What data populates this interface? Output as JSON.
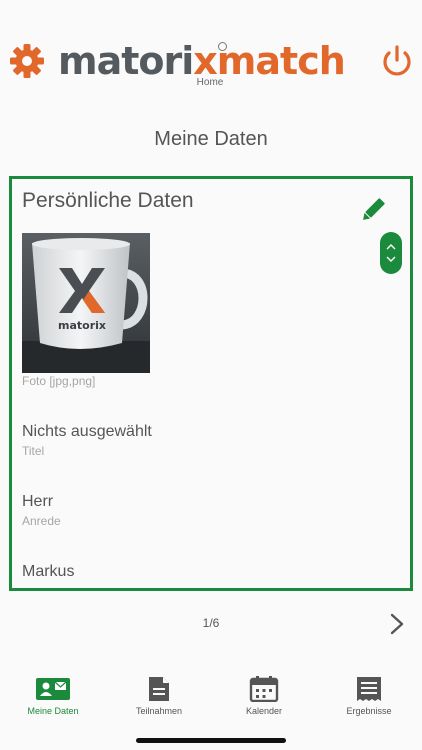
{
  "header": {
    "logo_part1": "matori",
    "logo_x": "x",
    "logo_part2": "match",
    "home_label": "Home",
    "settings_icon": "gear-icon",
    "logout_icon": "power-icon"
  },
  "page": {
    "title": "Meine Daten"
  },
  "card": {
    "title": "Persönliche Daten",
    "edit_icon": "pencil-icon",
    "photo_caption_brand": "matorix",
    "photo_label": "Foto [jpg,png]",
    "fields": [
      {
        "value": "Nichts ausgewählt",
        "label": "Titel"
      },
      {
        "value": "Herr",
        "label": "Anrede"
      },
      {
        "value": "Markus",
        "label": ""
      }
    ]
  },
  "pager": {
    "text": "1/6"
  },
  "tabs": [
    {
      "label": "Meine Daten",
      "icon": "id-card-icon",
      "active": true
    },
    {
      "label": "Teilnahmen",
      "icon": "document-icon",
      "active": false
    },
    {
      "label": "Kalender",
      "icon": "calendar-icon",
      "active": false
    },
    {
      "label": "Ergebnisse",
      "icon": "receipt-icon",
      "active": false
    }
  ],
  "colors": {
    "accent_green": "#1b8a3c",
    "brand_orange": "#e1672a",
    "brand_gray": "#555a5e"
  }
}
